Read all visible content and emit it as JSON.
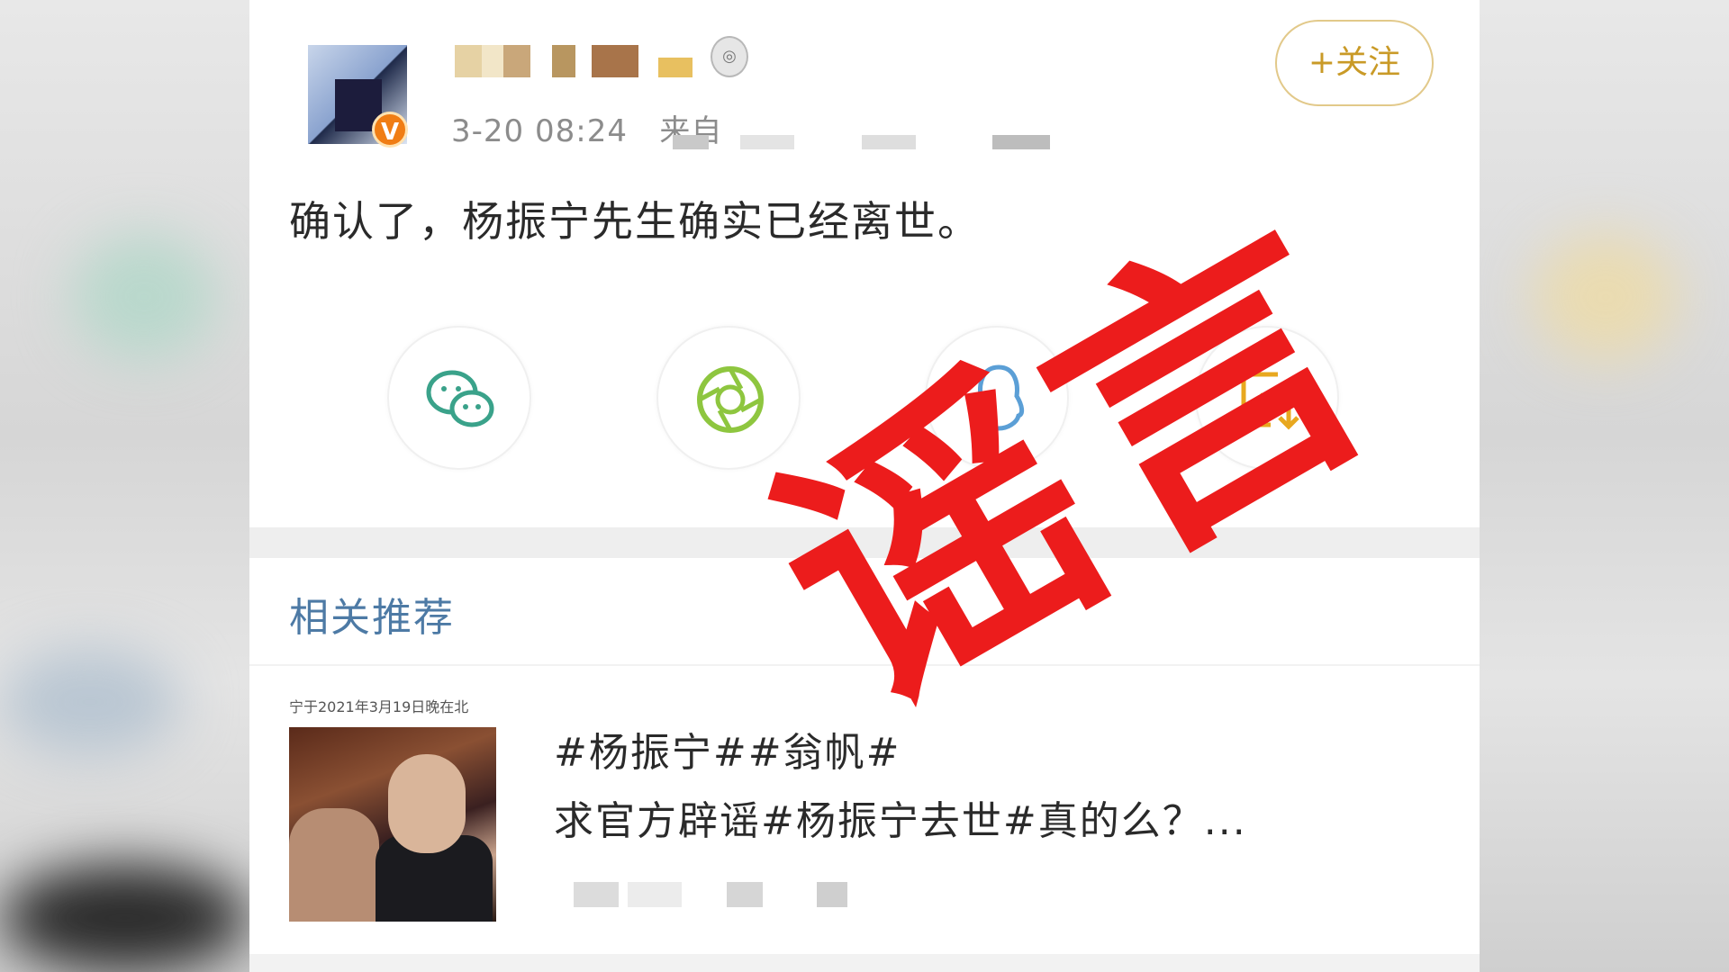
{
  "post": {
    "timestamp": "3-20 08:24",
    "source_prefix": "来自",
    "follow_label": "+关注",
    "text": "确认了，杨振宁先生确实已经离世。",
    "verified_badge": "V",
    "level_icon": "medal-icon"
  },
  "share": {
    "items": [
      {
        "icon": "wechat-icon",
        "color": "#3aa28a"
      },
      {
        "icon": "moments-icon",
        "color": "#8ec63f"
      },
      {
        "icon": "qq-icon",
        "color": "#5b9fd6"
      },
      {
        "icon": "save-image-icon",
        "color": "#e8a81f"
      }
    ]
  },
  "recommend": {
    "title": "相关推荐",
    "thumbnail_caption": "宁于2021年3月19日晚在北",
    "line1": "#杨振宁##翁帆#",
    "line2": "求官方辟谣#杨振宁去世#真的么？..."
  },
  "stamp": {
    "text_1": "谣",
    "text_2": "言",
    "color": "#ec1c1c"
  }
}
